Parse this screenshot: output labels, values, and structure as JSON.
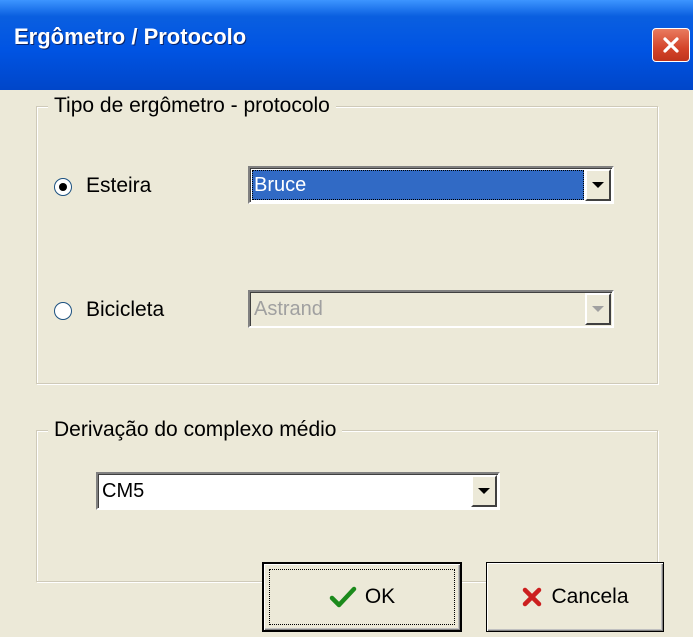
{
  "window": {
    "title": "Ergômetro / Protocolo"
  },
  "group_protocol": {
    "legend": "Tipo de ergômetro - protocolo",
    "esteira": {
      "label": "Esteira",
      "checked": true,
      "selected_value": "Bruce"
    },
    "bicicleta": {
      "label": "Bicicleta",
      "checked": false,
      "selected_value": "Astrand"
    }
  },
  "group_derivation": {
    "legend": "Derivação do complexo médio",
    "selected_value": "CM5"
  },
  "buttons": {
    "ok": "OK",
    "cancel": "Cancela"
  },
  "icons": {
    "close": "close-icon",
    "ok": "checkmark-icon",
    "cancel": "x-icon"
  },
  "colors": {
    "titlebar": "#0054e3",
    "selection": "#316ac5",
    "face": "#ece9d8",
    "ok_icon": "#1b8a1b",
    "cancel_icon": "#cc1f1f"
  }
}
